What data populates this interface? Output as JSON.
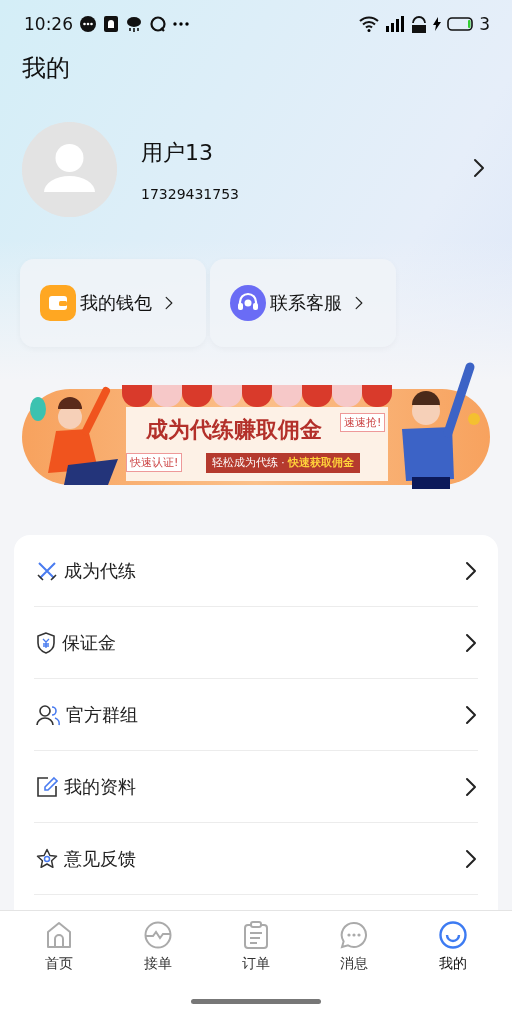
{
  "status_bar": {
    "time": "10:26",
    "battery": "3"
  },
  "page_title": "我的",
  "profile": {
    "name": "用户13",
    "phone": "17329431753"
  },
  "quick_actions": [
    {
      "label": "我的钱包",
      "color": "#ffa722"
    },
    {
      "label": "联系客服",
      "color": "#6a6cf5"
    }
  ],
  "banner": {
    "title": "成为代练赚取佣金",
    "tag_left": "快速认证!",
    "tag_right": "速速抢!",
    "slogan": "轻松成为代练 · ",
    "slogan_highlight": "快速获取佣金"
  },
  "menu": [
    {
      "label": "成为代练"
    },
    {
      "label": "保证金"
    },
    {
      "label": "官方群组"
    },
    {
      "label": "我的资料"
    },
    {
      "label": "意见反馈"
    }
  ],
  "tab_bar": [
    {
      "label": "首页",
      "selected": false
    },
    {
      "label": "接单",
      "selected": false
    },
    {
      "label": "订单",
      "selected": false
    },
    {
      "label": "消息",
      "selected": false
    },
    {
      "label": "我的",
      "selected": true
    }
  ]
}
